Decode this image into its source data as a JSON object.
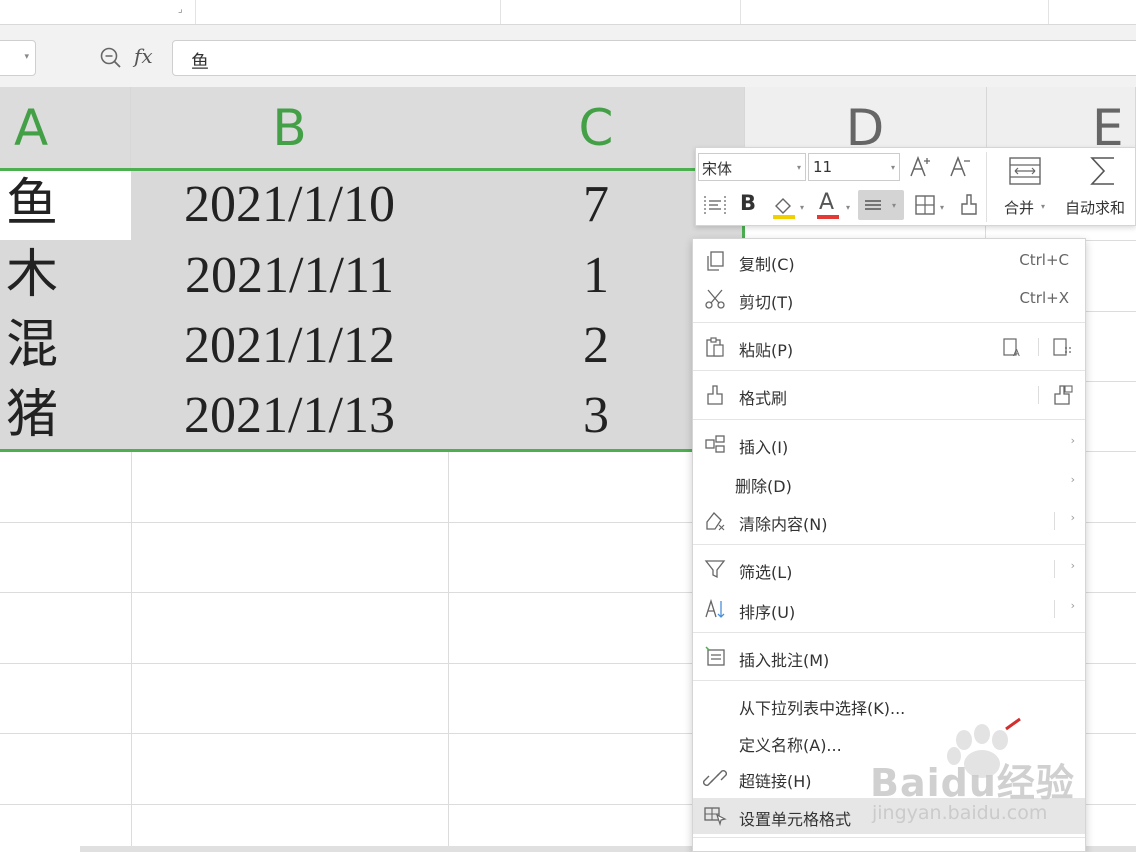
{
  "formula_bar": {
    "fx_label": "fx",
    "value": "鱼"
  },
  "columns": [
    "A",
    "B",
    "C",
    "D",
    "E"
  ],
  "rows": [
    {
      "a": "鱼",
      "b": "2021/1/10",
      "c": "7"
    },
    {
      "a": "木",
      "b": "2021/1/11",
      "c": "1"
    },
    {
      "a": "混",
      "b": "2021/1/12",
      "c": "2"
    },
    {
      "a": "猪",
      "b": "2021/1/13",
      "c": "3"
    }
  ],
  "mini_toolbar": {
    "font_name": "宋体",
    "font_size": "11",
    "bold": "B",
    "font_color_letter": "A",
    "merge_label": "合并",
    "autosum_label": "自动求和",
    "grow_font_icon": "font-grow-icon",
    "shrink_font_icon": "font-shrink-icon"
  },
  "context_menu": {
    "copy": {
      "label": "复制(C)",
      "shortcut": "Ctrl+C"
    },
    "cut": {
      "label": "剪切(T)",
      "shortcut": "Ctrl+X"
    },
    "paste": {
      "label": "粘贴(P)"
    },
    "format_painter": {
      "label": "格式刷"
    },
    "insert": {
      "label": "插入(I)"
    },
    "delete": {
      "label": "删除(D)"
    },
    "clear": {
      "label": "清除内容(N)"
    },
    "filter": {
      "label": "筛选(L)"
    },
    "sort": {
      "label": "排序(U)"
    },
    "insert_comment": {
      "label": "插入批注(M)"
    },
    "pick_from_list": {
      "label": "从下拉列表中选择(K)..."
    },
    "define_name": {
      "label": "定义名称(A)..."
    },
    "hyperlink": {
      "label": "超链接(H)"
    },
    "format_cells": {
      "label": "设置单元格格式"
    }
  },
  "watermark": {
    "brand": "Baidu经验",
    "url": "jingyan.baidu.com"
  },
  "colors": {
    "selection_green": "#4caf50",
    "selected_fill": "#d9d9d9",
    "header_bg": "#efefef",
    "menu_highlight": "#e6e6e6"
  }
}
